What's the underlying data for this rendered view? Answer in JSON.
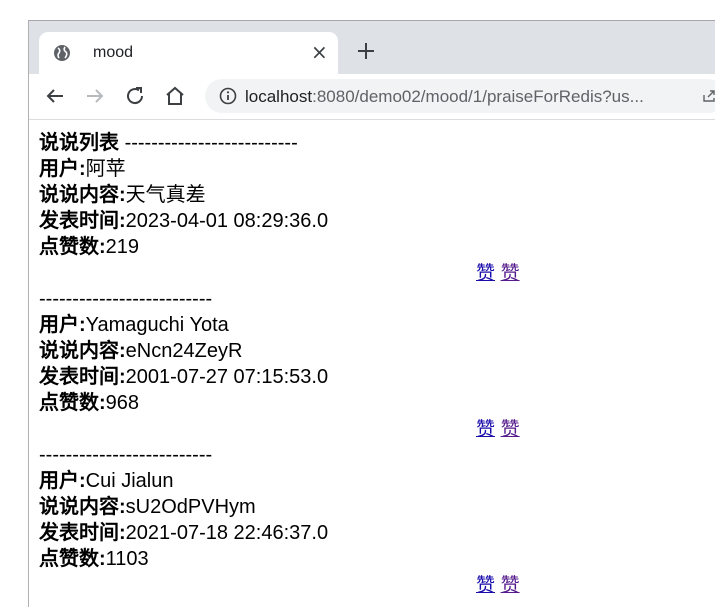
{
  "browser": {
    "tab_title": "mood",
    "close_glyph": "×",
    "url_host": "localhost",
    "url_path": ":8080/demo02/mood/1/praiseForRedis?us..."
  },
  "page": {
    "header_title": "说说列表",
    "separator": "--------------------------",
    "labels": {
      "user": "用户:",
      "content": "说说内容:",
      "time": "发表时间:",
      "likes": "点赞数:"
    },
    "moods": [
      {
        "user": "阿苹",
        "content": "天气真差",
        "time": "2023-04-01 08:29:36.0",
        "likes": "219",
        "links": [
          "赞",
          "赞"
        ]
      },
      {
        "user": "Yamaguchi Yota",
        "content": "eNcn24ZeyR",
        "time": "2001-07-27 07:15:53.0",
        "likes": "968",
        "links": [
          "赞",
          "赞"
        ]
      },
      {
        "user": "Cui Jialun",
        "content": "sU2OdPVHym",
        "time": "2021-07-18 22:46:37.0",
        "likes": "1103",
        "links": [
          "赞",
          "赞"
        ]
      }
    ]
  }
}
